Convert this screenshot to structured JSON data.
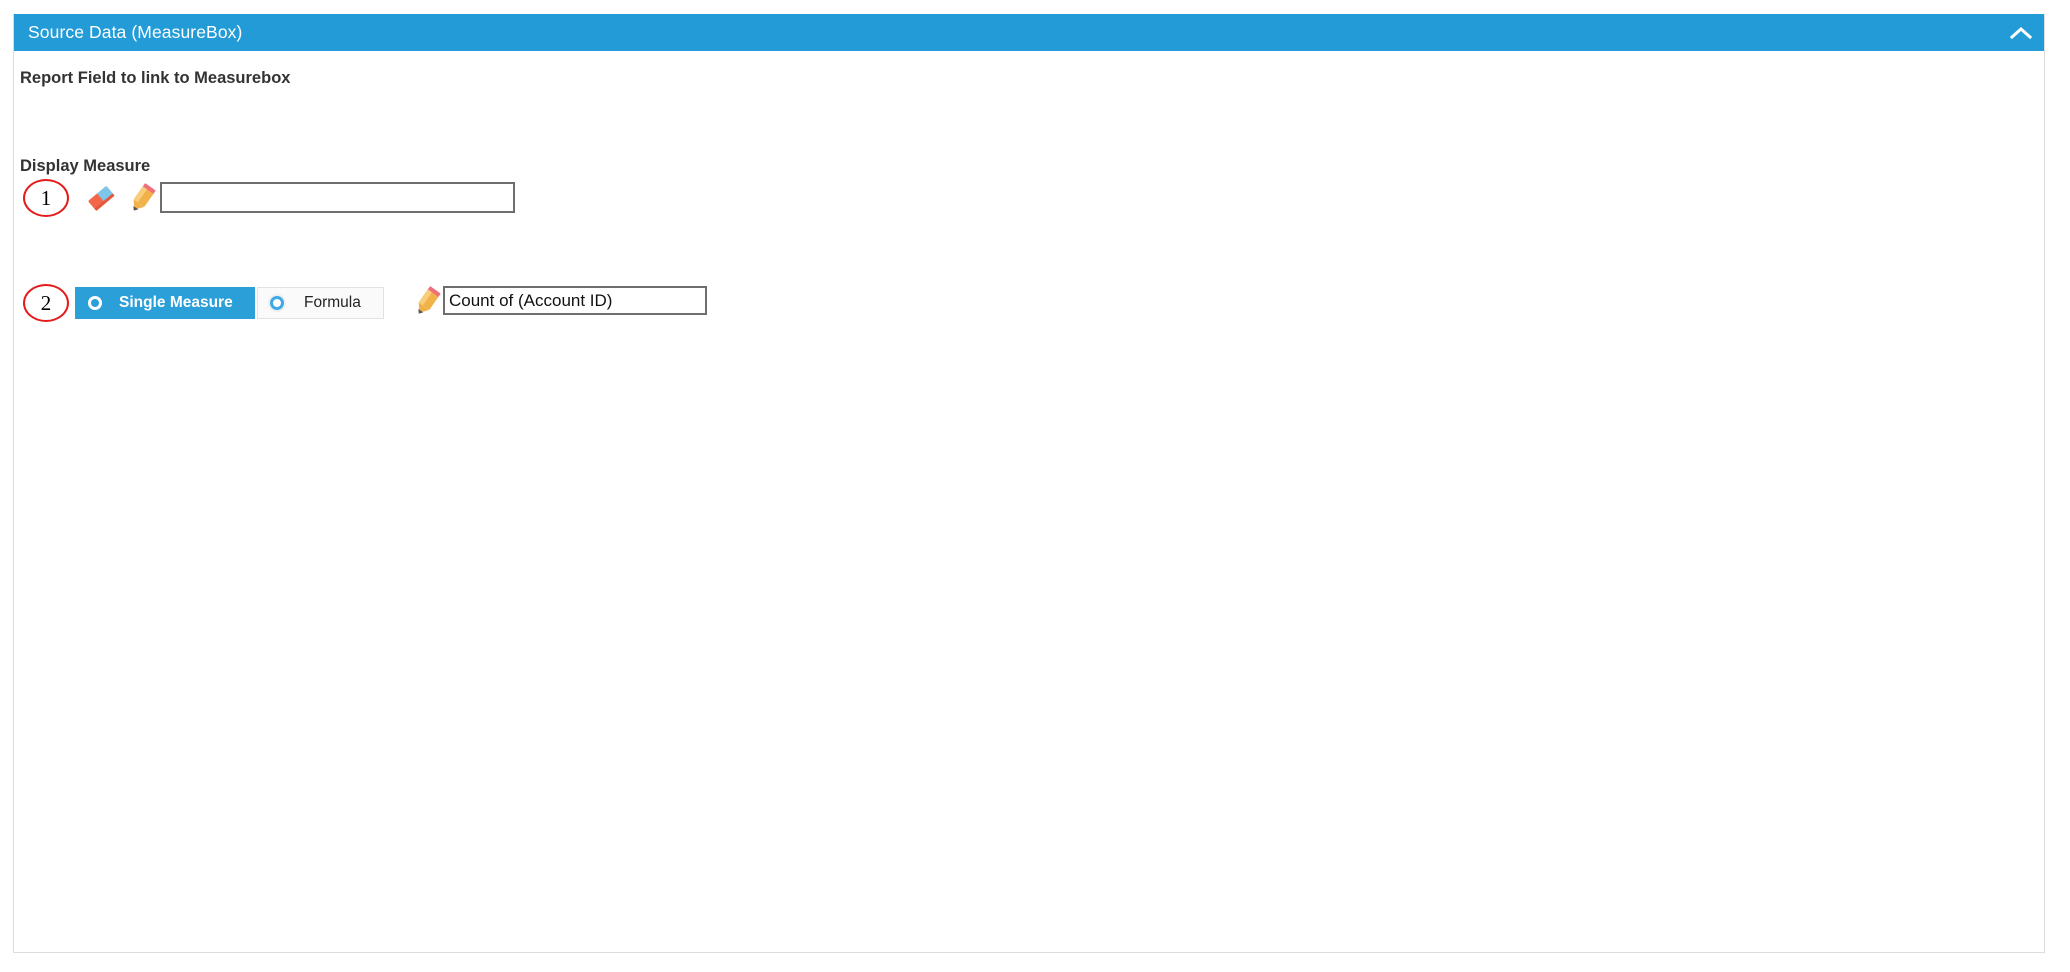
{
  "panel": {
    "title": "Source Data (MeasureBox)",
    "header_color": "#229bd7",
    "collapse_icon": "chevron-up-icon"
  },
  "fields": {
    "report_field": {
      "label": "Report Field to link to Measurebox",
      "value": "",
      "placeholder": "",
      "eraser_icon": "eraser-icon",
      "pencil_icon": "pencil-icon"
    },
    "display_measure": {
      "label": "Display Measure",
      "options": [
        {
          "label": "Single Measure",
          "selected": true
        },
        {
          "label": "Formula",
          "selected": false
        }
      ],
      "measure_value": "Count of (Account ID)",
      "measure_placeholder": "",
      "pencil_icon": "pencil-icon"
    }
  },
  "annotations": [
    {
      "number": "1",
      "color": "#e41b1b"
    },
    {
      "number": "2",
      "color": "#e41b1b"
    }
  ]
}
